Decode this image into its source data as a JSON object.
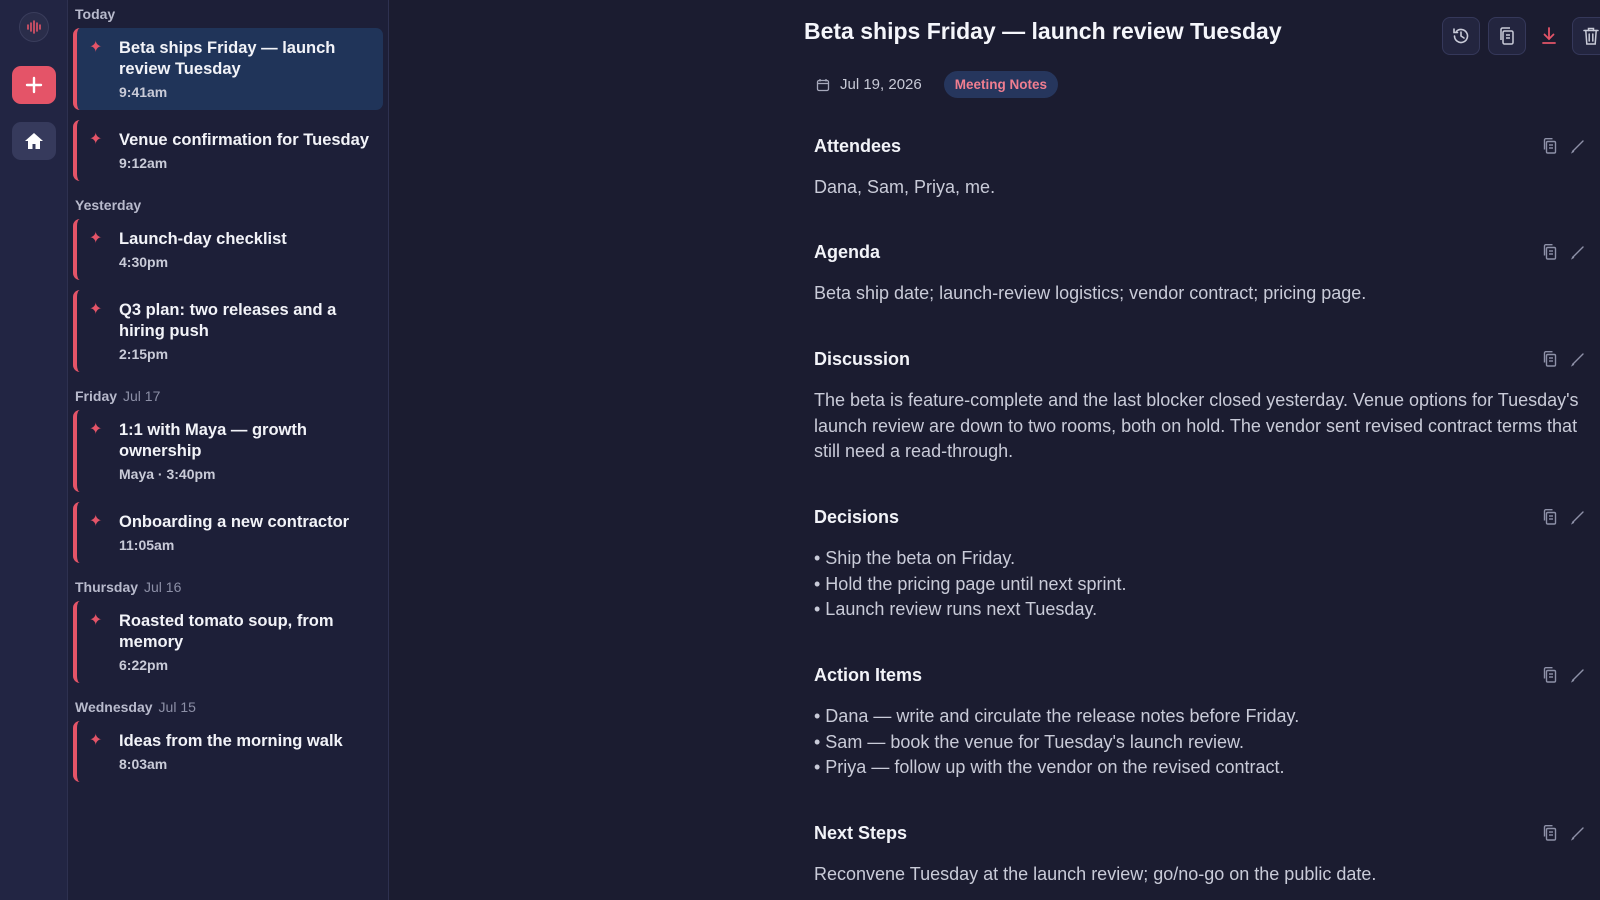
{
  "sidebar": {
    "groups": [
      {
        "label": "Today",
        "date": "",
        "items": [
          {
            "title": "Beta ships Friday — launch review Tuesday",
            "meta": "9:41am"
          },
          {
            "title": "Venue confirmation for Tuesday",
            "meta": "9:12am"
          }
        ]
      },
      {
        "label": "Yesterday",
        "date": "",
        "items": [
          {
            "title": "Launch-day checklist",
            "meta": "4:30pm"
          },
          {
            "title": "Q3 plan: two releases and a hiring push",
            "meta": "2:15pm"
          }
        ]
      },
      {
        "label": "Friday",
        "date": "Jul 17",
        "items": [
          {
            "title": "1:1 with Maya — growth ownership",
            "meta": "Maya · 3:40pm"
          },
          {
            "title": "Onboarding a new contractor",
            "meta": "11:05am"
          }
        ]
      },
      {
        "label": "Thursday",
        "date": "Jul 16",
        "items": [
          {
            "title": "Roasted tomato soup, from memory",
            "meta": "6:22pm"
          }
        ]
      },
      {
        "label": "Wednesday",
        "date": "Jul 15",
        "items": [
          {
            "title": "Ideas from the morning walk",
            "meta": "8:03am"
          }
        ]
      }
    ]
  },
  "doc": {
    "title": "Beta ships Friday — launch review Tuesday",
    "date": "Jul 19, 2026",
    "tag": "Meeting Notes",
    "sections": [
      {
        "title": "Attendees",
        "lines": [
          "Dana, Sam, Priya, me."
        ]
      },
      {
        "title": "Agenda",
        "lines": [
          "Beta ship date; launch-review logistics; vendor contract; pricing page."
        ]
      },
      {
        "title": "Discussion",
        "lines": [
          "The beta is feature-complete and the last blocker closed yesterday. Venue options for Tuesday's launch review are down to two rooms, both on hold. The vendor sent revised contract terms that still need a read-through."
        ]
      },
      {
        "title": "Decisions",
        "lines": [
          "• Ship the beta on Friday.",
          "• Hold the pricing page until next sprint.",
          "• Launch review runs next Tuesday."
        ]
      },
      {
        "title": "Action Items",
        "lines": [
          "• Dana — write and circulate the release notes before Friday.",
          "• Sam — book the venue for Tuesday's launch review.",
          "• Priya — follow up with the vendor on the revised contract."
        ]
      },
      {
        "title": "Next Steps",
        "lines": [
          "Reconvene Tuesday at the launch review; go/no-go on the public date."
        ]
      }
    ]
  },
  "colors": {
    "accent": "#e45468",
    "active_item": "#203459",
    "tag_bg": "#26365d",
    "tag_text": "#f07e90"
  },
  "icons": {
    "rail": [
      "waveform-logo-icon",
      "plus-icon",
      "home-icon"
    ],
    "toolbar": [
      "history-icon",
      "copy-icon",
      "download-icon",
      "trash-icon"
    ],
    "section_tools": [
      "copy-icon",
      "edit-pencil-icon"
    ],
    "list_item": "sparkle-icon",
    "date": "calendar-icon"
  }
}
